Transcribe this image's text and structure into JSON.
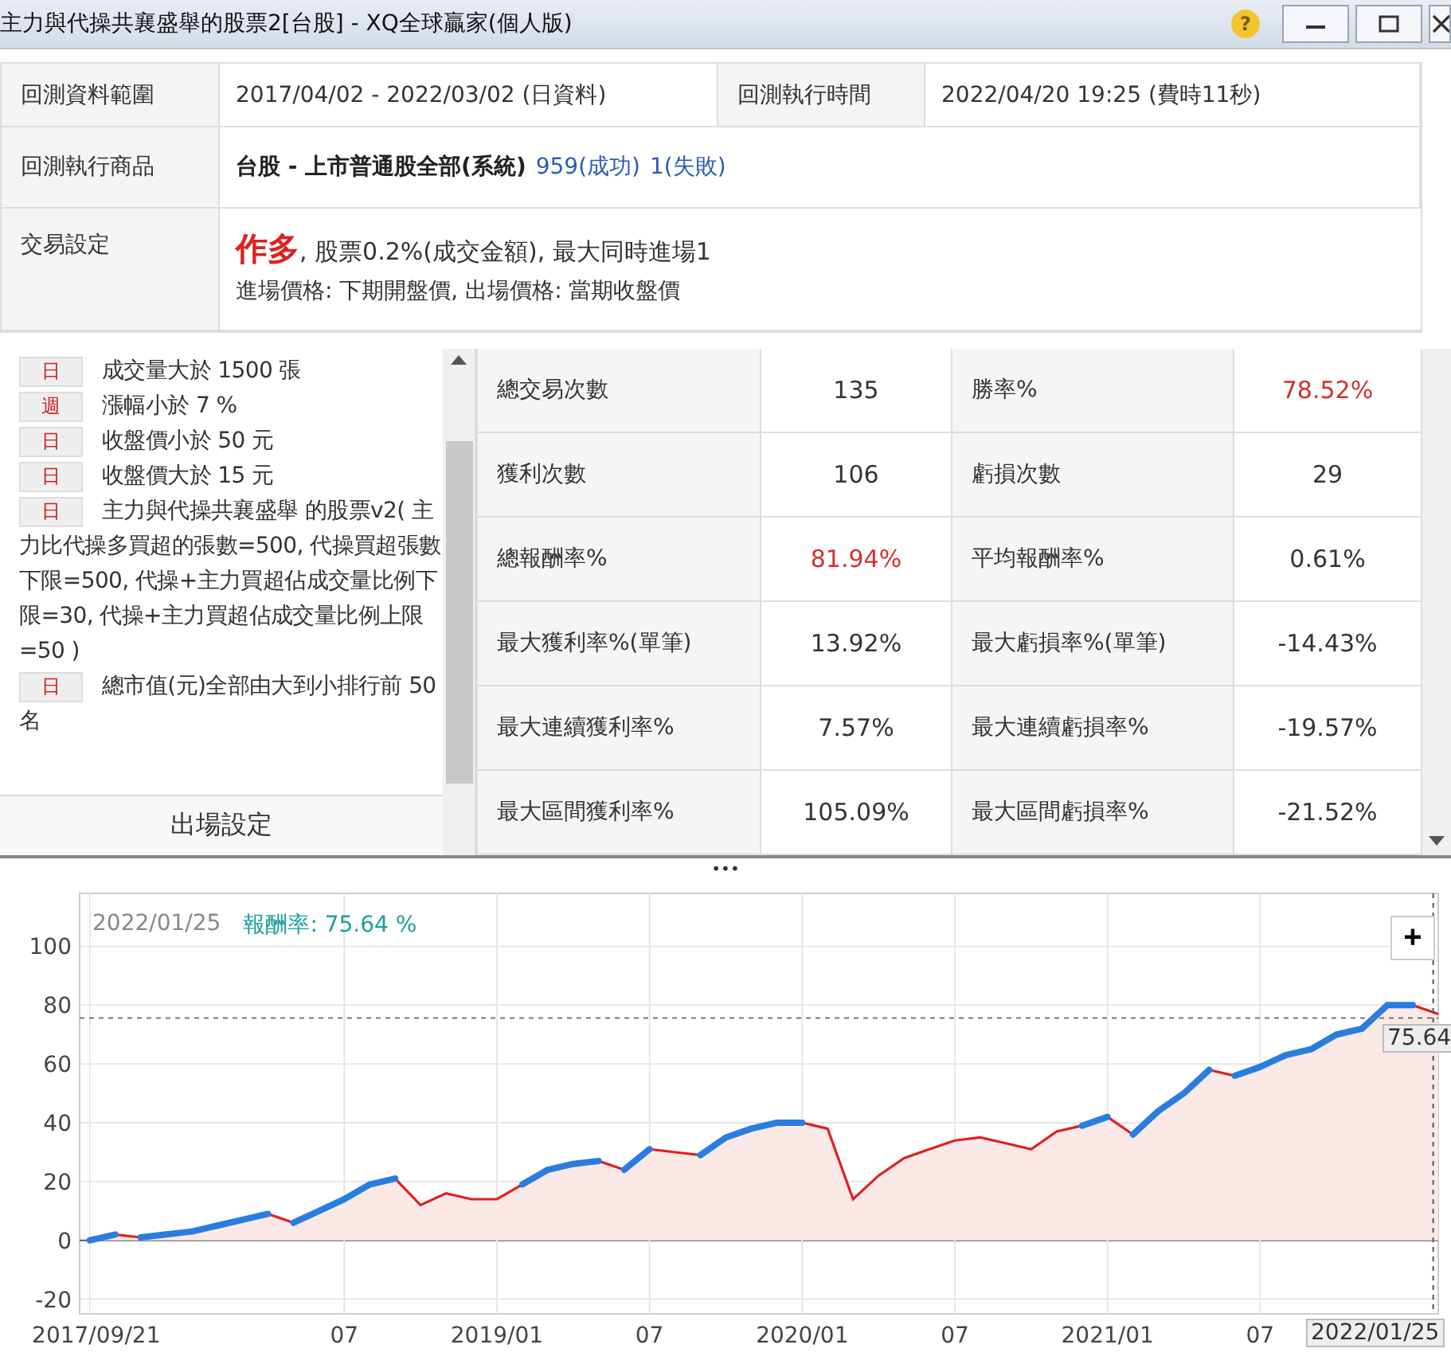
{
  "window": {
    "title": "主力與代操共襄盛舉的股票2[台股] - XQ全球贏家(個人版)",
    "help": "?"
  },
  "summary": {
    "range": {
      "label": "回測資料範圍",
      "value": "2017/04/02 - 2022/03/02 (日資料)"
    },
    "run_time": {
      "label": "回測執行時間",
      "value": "2022/04/20 19:25 (費時11秒)"
    },
    "products": {
      "label": "回測執行商品",
      "market": "台股 - 上市普通股全部(系統)",
      "success": "959(成功)",
      "failed": "1(失敗)"
    },
    "trade": {
      "label": "交易設定",
      "direction": "作多",
      "details": ", 股票0.2%(成交金額), 最大同時進場1",
      "prices": "進場價格: 下期開盤價, 出場價格: 當期收盤價"
    }
  },
  "conditions": [
    {
      "period": "日",
      "text": "成交量大於 1500 張"
    },
    {
      "period": "週",
      "text": "漲幅小於 7 %"
    },
    {
      "period": "日",
      "text": "收盤價小於 50 元"
    },
    {
      "period": "日",
      "text": "收盤價大於 15 元"
    },
    {
      "period": "日",
      "text": "主力與代操共襄盛舉 的股票v2( 主力比代操多買超的張數=500, 代操買超張數下限=500, 代操+主力買超佔成交量比例下限=30, 代操+主力買超佔成交量比例上限=50 )"
    },
    {
      "period": "日",
      "text": "總市值(元)全部由大到小排行前 50 名"
    }
  ],
  "exit_settings": "出場設定",
  "stats": [
    [
      {
        "label": "總交易次數",
        "value": "135",
        "emphasis": false
      },
      {
        "label": "勝率%",
        "value": "78.52%",
        "emphasis": true
      }
    ],
    [
      {
        "label": "獲利次數",
        "value": "106",
        "emphasis": false
      },
      {
        "label": "虧損次數",
        "value": "29",
        "emphasis": false
      }
    ],
    [
      {
        "label": "總報酬率%",
        "value": "81.94%",
        "emphasis": true
      },
      {
        "label": "平均報酬率%",
        "value": "0.61%",
        "emphasis": false
      }
    ],
    [
      {
        "label": "最大獲利率%(單筆)",
        "value": "13.92%",
        "emphasis": false
      },
      {
        "label": "最大虧損率%(單筆)",
        "value": "-14.43%",
        "emphasis": false
      }
    ],
    [
      {
        "label": "最大連續獲利率%",
        "value": "7.57%",
        "emphasis": false
      },
      {
        "label": "最大連續虧損率%",
        "value": "-19.57%",
        "emphasis": false
      }
    ],
    [
      {
        "label": "最大區間獲利率%",
        "value": "105.09%",
        "emphasis": false
      },
      {
        "label": "最大區間虧損率%",
        "value": "-21.52%",
        "emphasis": false
      }
    ]
  ],
  "splitter": "•••",
  "chart": {
    "tooltip_date": "2022/01/25",
    "tooltip_value": ": 75.64 %",
    "zoom": "+",
    "cursor_value": "75.64",
    "cursor_date": "2022/01/25",
    "chart_data": {
      "type": "area",
      "categories": [
        "2017/09/21",
        null,
        null,
        null,
        null,
        null,
        null,
        null,
        null,
        null,
        "07",
        null,
        null,
        null,
        null,
        null,
        "2019/01",
        null,
        null,
        null,
        null,
        null,
        "07",
        null,
        null,
        null,
        null,
        null,
        "2020/01",
        null,
        null,
        null,
        null,
        null,
        "07",
        null,
        null,
        null,
        null,
        null,
        "2021/01",
        null,
        null,
        null,
        null,
        null,
        "07",
        null,
        null,
        null,
        null,
        null,
        null,
        null
      ],
      "series": [
        {
          "name": "報酬率",
          "color": "#e02020",
          "values": [
            0,
            2,
            1,
            2,
            3,
            5,
            7,
            9,
            6,
            10,
            14,
            19,
            21,
            12,
            16,
            14,
            14,
            19,
            24,
            26,
            27,
            24,
            31,
            30,
            29,
            35,
            38,
            40,
            40,
            38,
            14,
            22,
            28,
            31,
            34,
            35,
            33,
            31,
            37,
            39,
            42,
            36,
            44,
            50,
            58,
            56,
            59,
            63,
            65,
            70,
            72,
            80,
            80,
            77
          ]
        }
      ],
      "ylim": [
        -25,
        118
      ],
      "grid": true,
      "ref_lines": [
        {
          "axis": "y",
          "value": 75.64
        }
      ],
      "yticks": [
        -20,
        0,
        20,
        40,
        60,
        80,
        100
      ]
    }
  }
}
